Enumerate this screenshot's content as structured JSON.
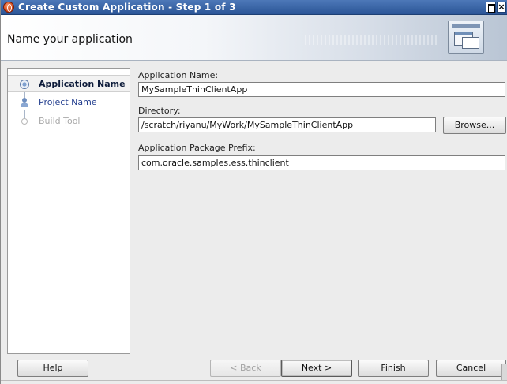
{
  "window": {
    "title": "Create Custom Application - Step 1 of 3"
  },
  "header": {
    "title": "Name your application"
  },
  "steps": [
    {
      "label": "Application Name",
      "state": "current"
    },
    {
      "label": "Project Name",
      "state": "link"
    },
    {
      "label": "Build Tool",
      "state": "disabled"
    }
  ],
  "form": {
    "app_name_label": "Application Name:",
    "app_name_value": "MySampleThinClientApp",
    "directory_label": "Directory:",
    "directory_value": "/scratch/riyanu/MyWork/MySampleThinClientApp",
    "browse_label": "Browse...",
    "prefix_label": "Application Package Prefix:",
    "prefix_value": "com.oracle.samples.ess.thinclient"
  },
  "buttons": {
    "help": "Help",
    "back": "< Back",
    "next": "Next >",
    "finish": "Finish",
    "cancel": "Cancel"
  },
  "colors": {
    "title_bar": "#2b5597",
    "link": "#243f8f",
    "disabled_text": "#a9a9a9"
  },
  "icons": {
    "app": "oracle-app-icon",
    "header": "application-windows-icon",
    "step_current": "radio-dot-icon",
    "step_project": "user-icon",
    "step_disabled": "empty-circle-icon"
  }
}
